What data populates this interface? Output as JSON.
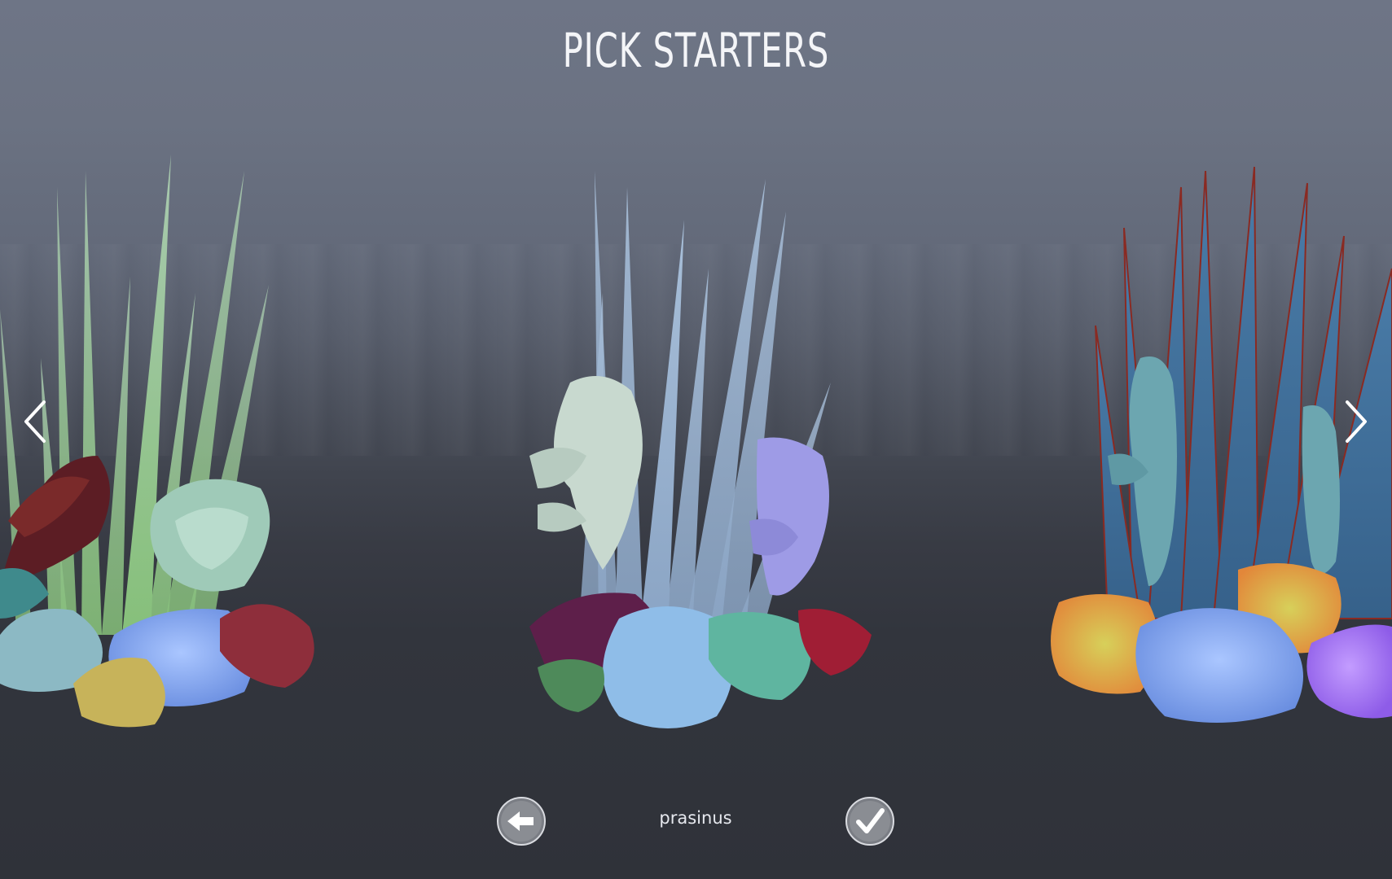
{
  "screen": {
    "title": "PICK STARTERS",
    "selected_name": "prasinus"
  },
  "controls": {
    "prev_icon": "chevron-left-icon",
    "next_icon": "chevron-right-icon",
    "back_icon": "back-arrow-icon",
    "confirm_icon": "checkmark-icon"
  },
  "colors": {
    "sky_top": "#6e7586",
    "ground": "#2f3239",
    "title_text": "#f4f5f8",
    "button_face": "#7a7d84"
  },
  "arrangements": [
    {
      "position": "left",
      "icon": "succulent-arrangement-green"
    },
    {
      "position": "center",
      "icon": "succulent-arrangement-pale-blue"
    },
    {
      "position": "right",
      "icon": "succulent-arrangement-blue-agave"
    }
  ]
}
